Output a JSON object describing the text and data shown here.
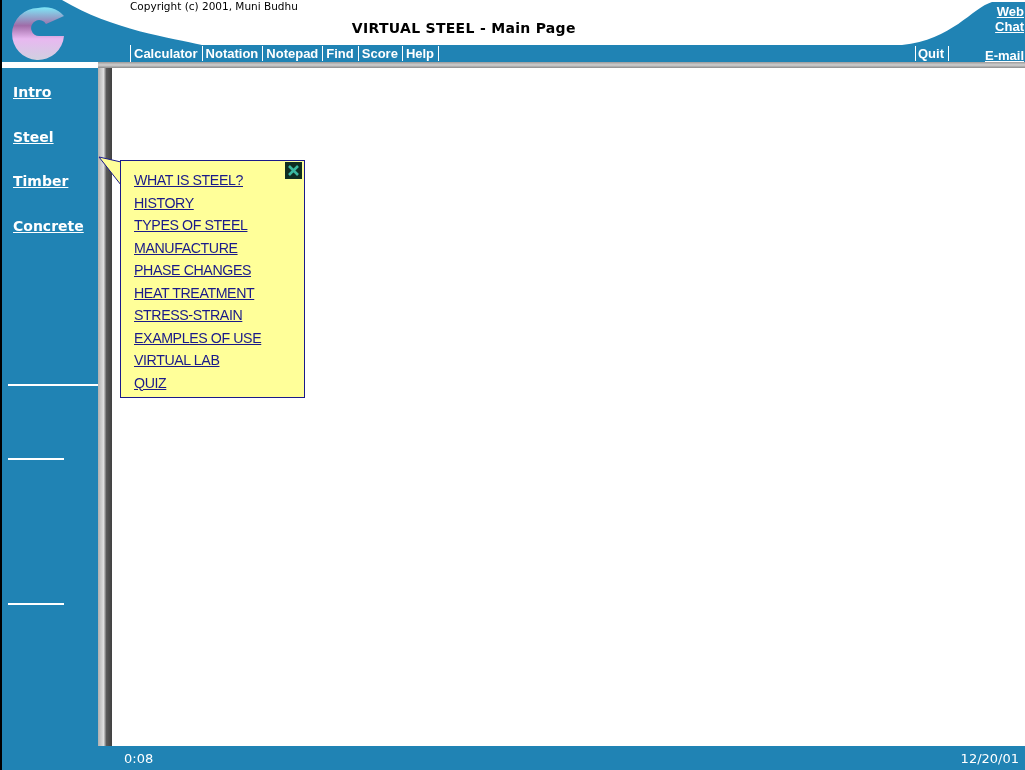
{
  "header": {
    "copyright": "Copyright (c) 2001, Muni Budhu",
    "title": "VIRTUAL STEEL - Main Page"
  },
  "toolbar": {
    "items": [
      "Calculator",
      "Notation",
      "Notepad",
      "Find",
      "Score",
      "Help"
    ],
    "quit": "Quit"
  },
  "side_links": [
    "Web",
    "Chat",
    "E-mail"
  ],
  "sidebar": {
    "items": [
      "Intro",
      "Steel",
      "Timber",
      "Concrete"
    ]
  },
  "popup": {
    "items": [
      "WHAT IS STEEL?",
      "HISTORY",
      "TYPES OF STEEL",
      "MANUFACTURE",
      "PHASE CHANGES",
      "HEAT TREATMENT",
      "STRESS-STRAIN",
      "EXAMPLES OF USE",
      "VIRTUAL LAB",
      "QUIZ"
    ]
  },
  "status_bar": {
    "timer": "0:08",
    "date": "12/20/01"
  }
}
